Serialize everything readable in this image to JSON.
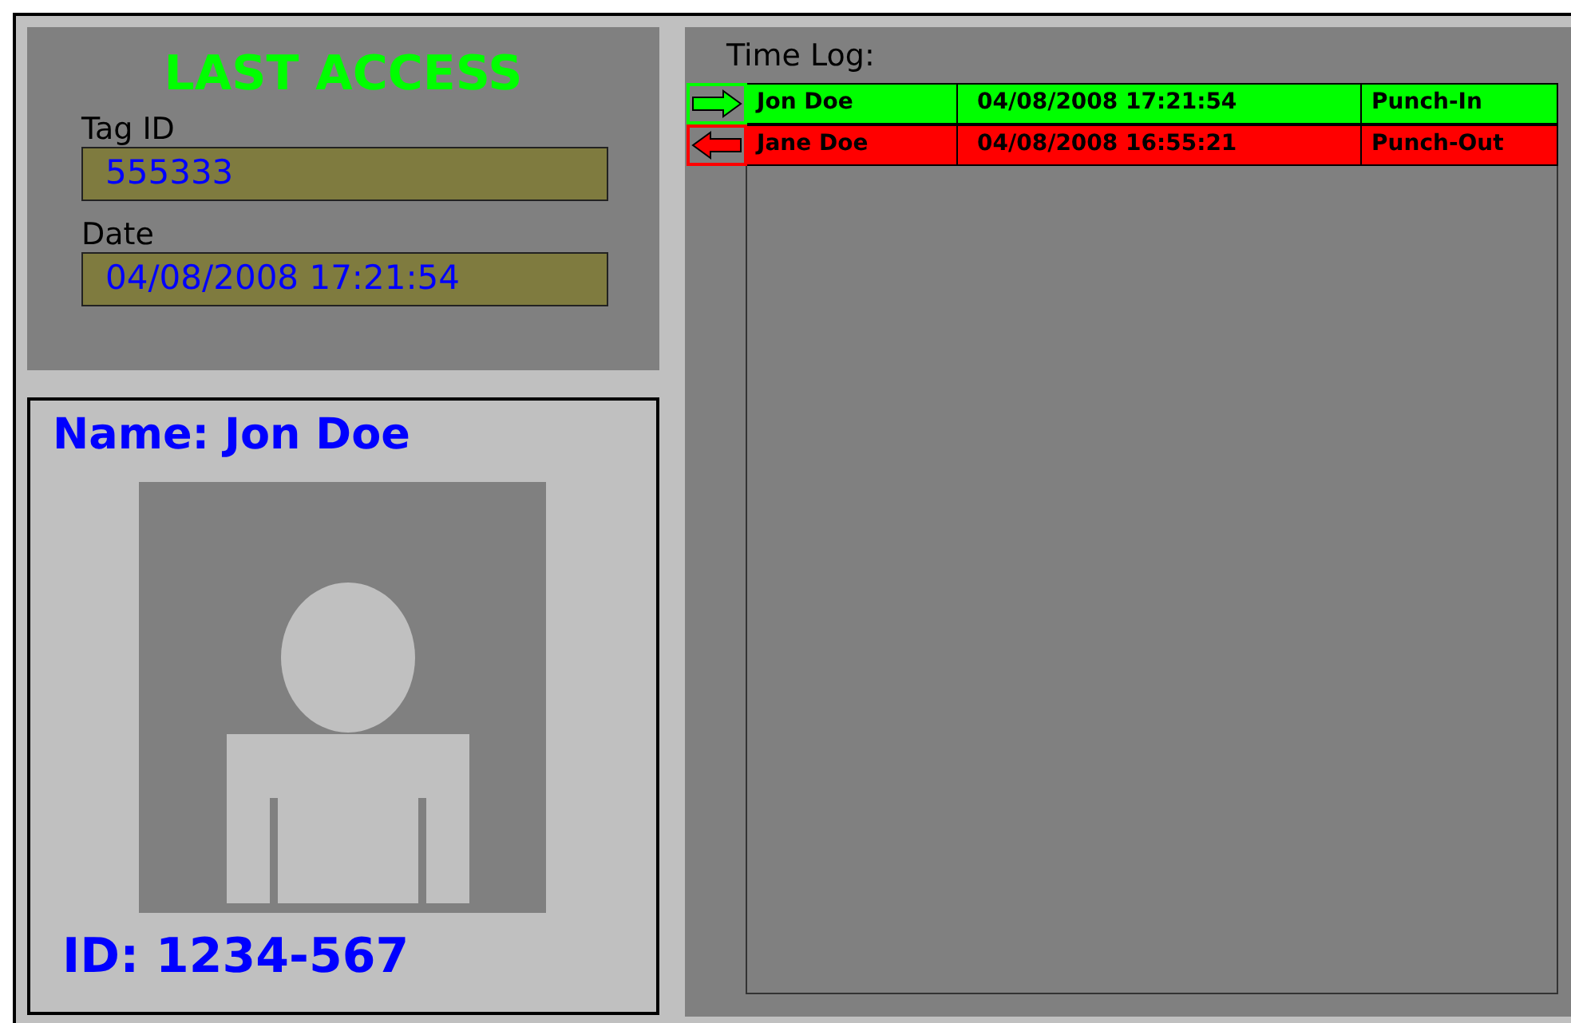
{
  "last_access": {
    "title": "LAST ACCESS",
    "fields": [
      {
        "label": "Tag ID",
        "value": "555333"
      },
      {
        "label": "Date",
        "value": "04/08/2008 17:21:54"
      }
    ]
  },
  "badge": {
    "name": "Name: Jon Doe",
    "id": "ID: 1234-567"
  },
  "time_log": {
    "title": "Time Log:",
    "rows": [
      {
        "kind": "in",
        "color": "#00ff00",
        "name": "Jon Doe",
        "date": "04/08/2008 17:21:54",
        "event": "Punch-In"
      },
      {
        "kind": "out",
        "color": "#ff0000",
        "name": "Jane Doe",
        "date": "04/08/2008 16:55:21",
        "event": "Punch-Out"
      }
    ]
  }
}
